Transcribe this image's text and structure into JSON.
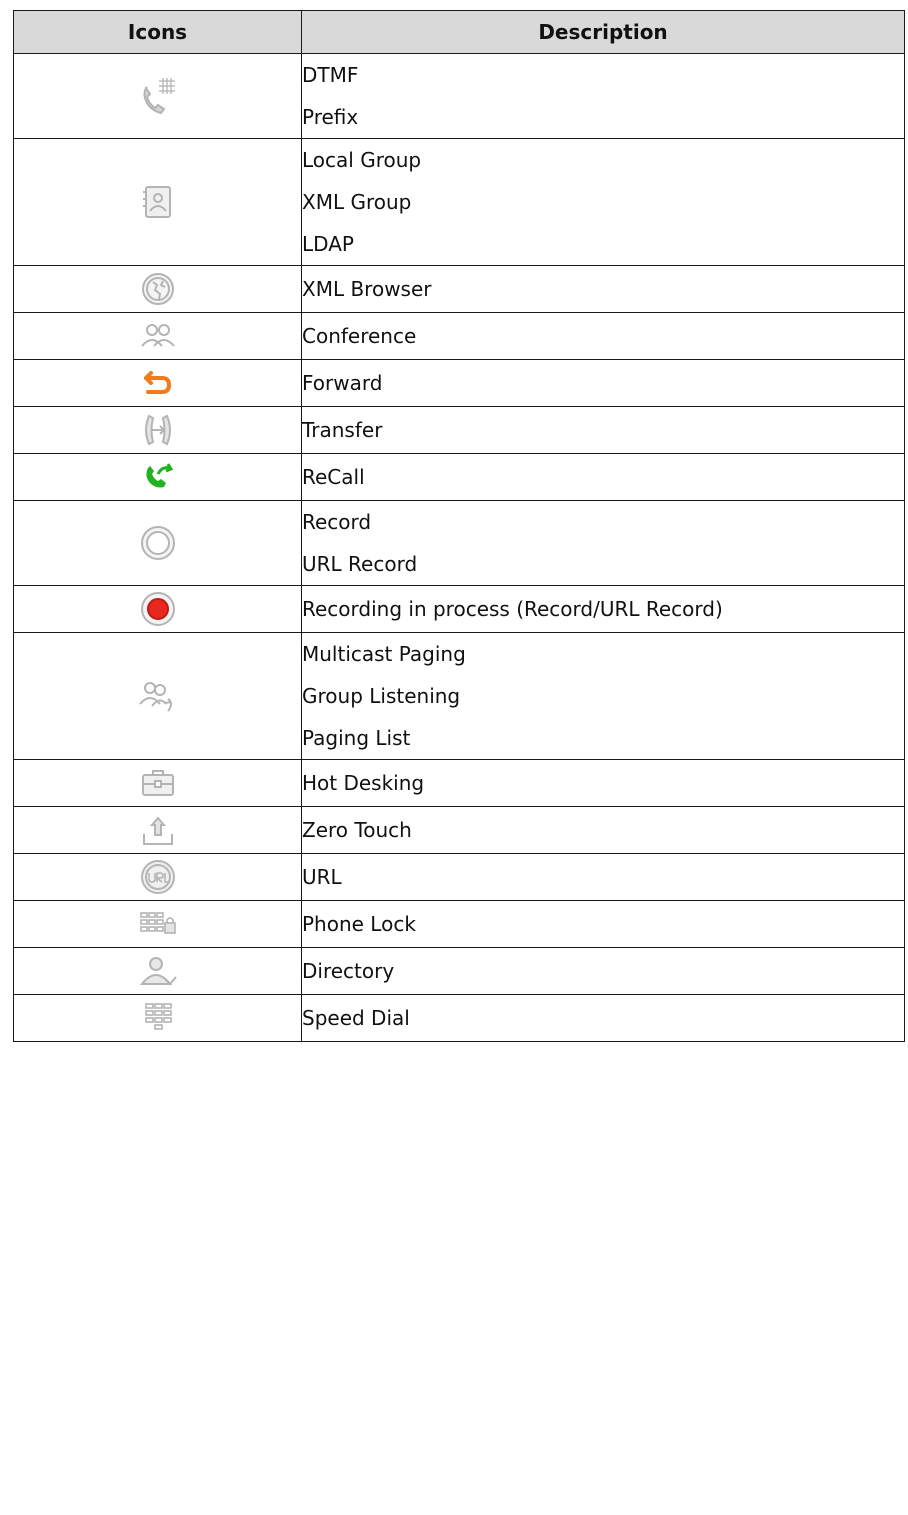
{
  "table": {
    "headers": {
      "icons": "Icons",
      "description": "Description"
    },
    "rows": [
      {
        "icon": "dtmf-phone-keypad-icon",
        "descriptions": [
          "DTMF",
          "Prefix"
        ]
      },
      {
        "icon": "contact-group-book-icon",
        "descriptions": [
          "Local Group",
          "XML Group",
          "LDAP"
        ]
      },
      {
        "icon": "xml-browser-globe-icon",
        "descriptions": [
          "XML Browser"
        ]
      },
      {
        "icon": "conference-people-icon",
        "descriptions": [
          "Conference"
        ]
      },
      {
        "icon": "forward-arrow-icon",
        "descriptions": [
          "Forward"
        ]
      },
      {
        "icon": "transfer-handsets-icon",
        "descriptions": [
          "Transfer"
        ]
      },
      {
        "icon": "recall-phone-icon",
        "descriptions": [
          "ReCall"
        ]
      },
      {
        "icon": "record-circle-icon",
        "descriptions": [
          "Record",
          "URL Record"
        ]
      },
      {
        "icon": "recording-active-icon",
        "descriptions": [
          "Recording in process (Record/URL Record)"
        ]
      },
      {
        "icon": "multicast-paging-icon",
        "descriptions": [
          "Multicast Paging",
          "Group Listening",
          "Paging List"
        ]
      },
      {
        "icon": "hot-desking-briefcase-icon",
        "descriptions": [
          "Hot Desking"
        ]
      },
      {
        "icon": "zero-touch-upload-icon",
        "descriptions": [
          "Zero Touch"
        ]
      },
      {
        "icon": "url-badge-icon",
        "descriptions": [
          "URL"
        ]
      },
      {
        "icon": "phone-lock-keypad-icon",
        "descriptions": [
          "Phone Lock"
        ]
      },
      {
        "icon": "directory-person-icon",
        "descriptions": [
          "Directory"
        ]
      },
      {
        "icon": "speed-dial-keypad-icon",
        "descriptions": [
          "Speed Dial"
        ]
      }
    ]
  },
  "colors": {
    "header_bg": "#d9d9d9",
    "icon_gray": "#b4b4b4",
    "forward_orange": "#f07a1e",
    "recall_green": "#22b322",
    "recording_red": "#e8281e"
  }
}
